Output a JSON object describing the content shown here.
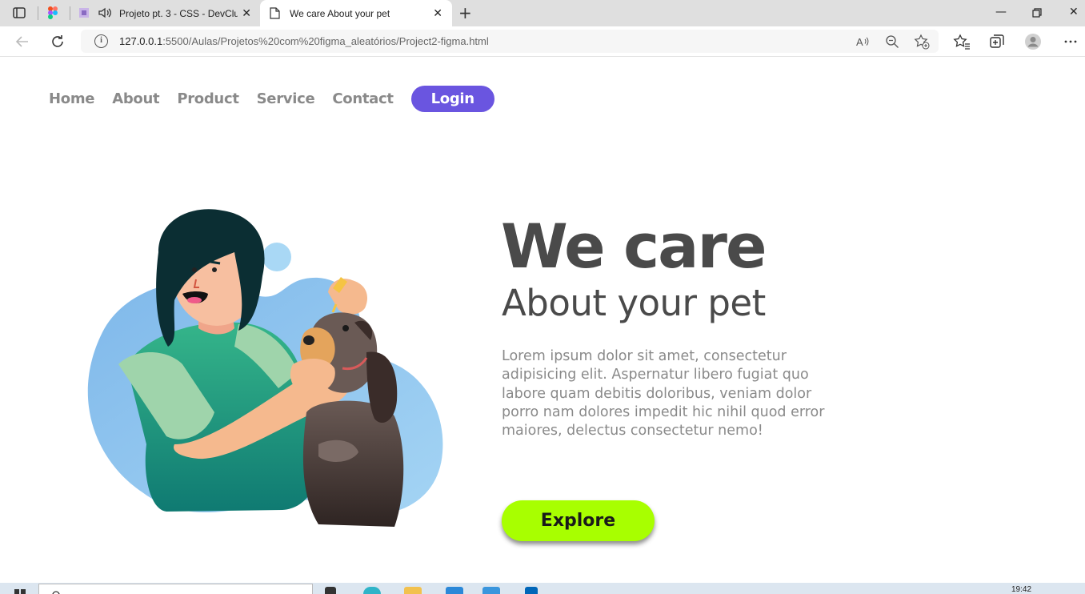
{
  "browser": {
    "tabs": [
      {
        "label": "Projeto pt. 3 - CSS - DevClu",
        "active": false
      },
      {
        "label": "We care About your pet",
        "active": true
      }
    ],
    "url_host": "127.0.0.1",
    "url_path": ":5500/Aulas/Projetos%20com%20figma_aleatórios/Project2-figma.html"
  },
  "nav": {
    "items": [
      "Home",
      "About",
      "Product",
      "Service",
      "Contact"
    ],
    "login": "Login"
  },
  "hero": {
    "title": "We care",
    "subtitle": "About your pet",
    "body": "Lorem ipsum dolor sit amet, consectetur adipisicing elit. Aspernatur libero fugiat quo labore quam debitis doloribus, veniam dolor porro nam dolores impedit hic nihil quod error maiores, delectus consectetur nemo!",
    "cta": "Explore"
  },
  "taskbar": {
    "time": "19:42"
  },
  "colors": {
    "login_bg": "#6a55e0",
    "cta_bg": "#a8ff00",
    "heading": "#4a4a4a",
    "nav_text": "#8a8a8a",
    "blob": "#8cc4ee"
  }
}
